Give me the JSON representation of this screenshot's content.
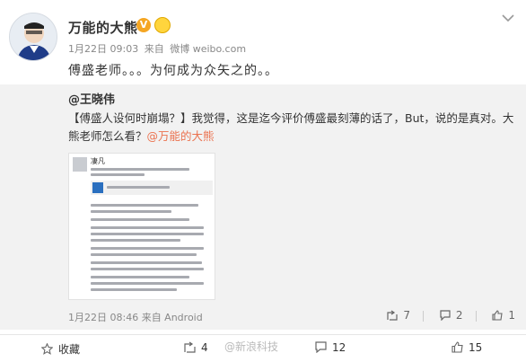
{
  "post": {
    "username": "万能的大熊",
    "v_badge": "V",
    "meta": {
      "date": "1月22日 09:03",
      "source_prefix": "来自",
      "source": "微博 weibo.com"
    },
    "text": "傅盛老师。。。为何成为众矢之的。。"
  },
  "repost": {
    "author": "@王晓伟",
    "text_main": "【傅盛人设何时崩塌？】我觉得，这是迄今评价傅盛最刻薄的话了，But，说的是真对。大熊老师怎么看？",
    "mention": "@万能的大熊",
    "thumbnail": {
      "name": "凄凡"
    },
    "time": "1月22日 08:46 来自 Android",
    "actions": {
      "repost_count": "7",
      "comment_count": "2",
      "like_count": "1"
    }
  },
  "action_bar": {
    "favorite_label": "收藏",
    "repost_count": "4",
    "comment_count": "12",
    "like_count": "15",
    "watermark": "@新浪科技"
  },
  "colors": {
    "accent": "#eb7350",
    "repost_bg": "#f2f2f2",
    "badge_gold": "#f5a623"
  }
}
